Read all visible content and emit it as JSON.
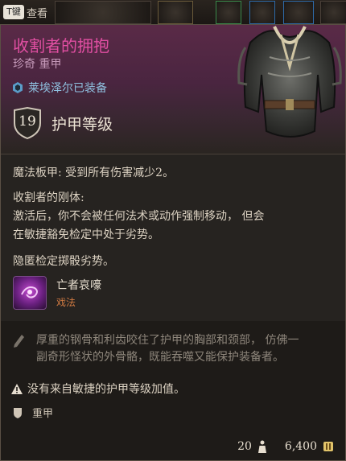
{
  "top_bar": {
    "key": "T键",
    "label": "查看"
  },
  "item": {
    "name": "收割者的拥抱",
    "rarity": "珍奇",
    "category": "重甲",
    "equipped_by": "莱埃泽尔已装备",
    "armor_class": "19",
    "armor_class_label": "护甲等级"
  },
  "properties": {
    "line1": "魔法板甲: 受到所有伤害减少2。",
    "ability_title": "收割者的刚体:",
    "ability_line1": "激活后，你不会被任何法术或动作强制移动， 但会",
    "ability_line2": "在敏捷豁免检定中处于劣势。",
    "stealth": "隐匿检定掷骰劣势。"
  },
  "spell": {
    "name": "亡者哀嚎",
    "type": "戏法",
    "icon": "wail-spell-icon"
  },
  "flavor": {
    "line1": "厚重的钢骨和利齿咬住了护甲的胸部和颈部， 仿佛一",
    "line2": "副奇形怪状的外骨骼，既能吞噬又能保护装备者。"
  },
  "warning": "没有来自敏捷的护甲等级加值。",
  "armor_type": "重甲",
  "footer": {
    "weight": "20",
    "price": "6,400"
  },
  "colors": {
    "name": "#e24fa3",
    "rarity": "#c79bbb",
    "equipped": "#8fc1e0",
    "spell_type": "#d07a42"
  }
}
